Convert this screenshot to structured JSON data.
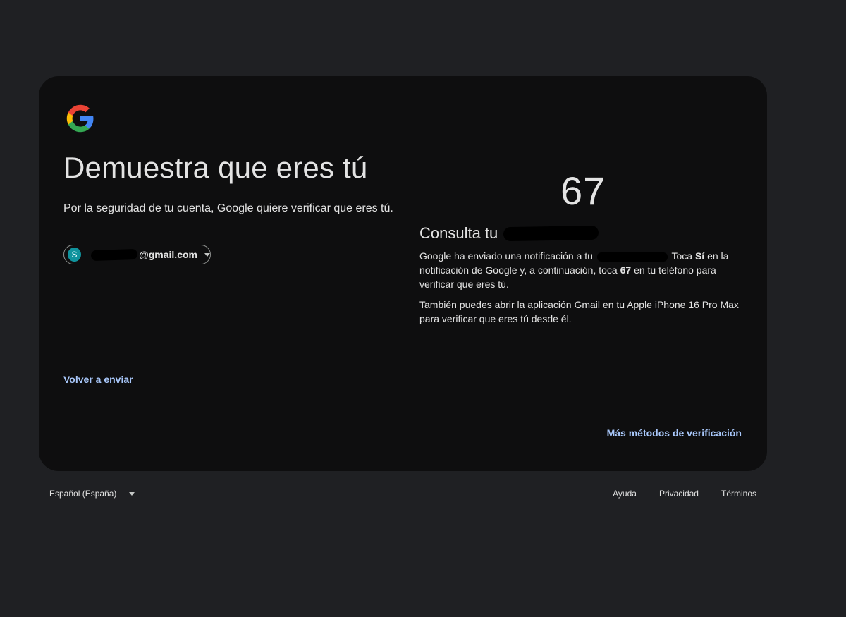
{
  "title": "Demuestra que eres tú",
  "subtitle": "Por la seguridad de tu cuenta, Google quiere verificar que eres tú.",
  "account": {
    "avatar_letter": "S",
    "email_domain": "@gmail.com"
  },
  "resend_label": "Volver a enviar",
  "verification": {
    "code": "67",
    "heading": "Consulta tu",
    "info_parts": {
      "p1": "Google ha enviado una notificación a tu",
      "p2": "Toca",
      "yes": "Sí",
      "p3": "en la notificación de Google y, a continuación, toca",
      "p4": "en tu teléfono para verificar que eres tú."
    },
    "alt_text": "También puedes abrir la aplicación Gmail en tu Apple iPhone 16 Pro Max para verificar que eres tú desde él."
  },
  "more_methods_label": "Más métodos de verificación",
  "footer": {
    "language": "Español (España)",
    "links": [
      "Ayuda",
      "Privacidad",
      "Términos"
    ]
  },
  "colors": {
    "background": "#1f2023",
    "card": "#0e0e0f",
    "link": "#a8c7fa",
    "avatar": "#10939d"
  }
}
